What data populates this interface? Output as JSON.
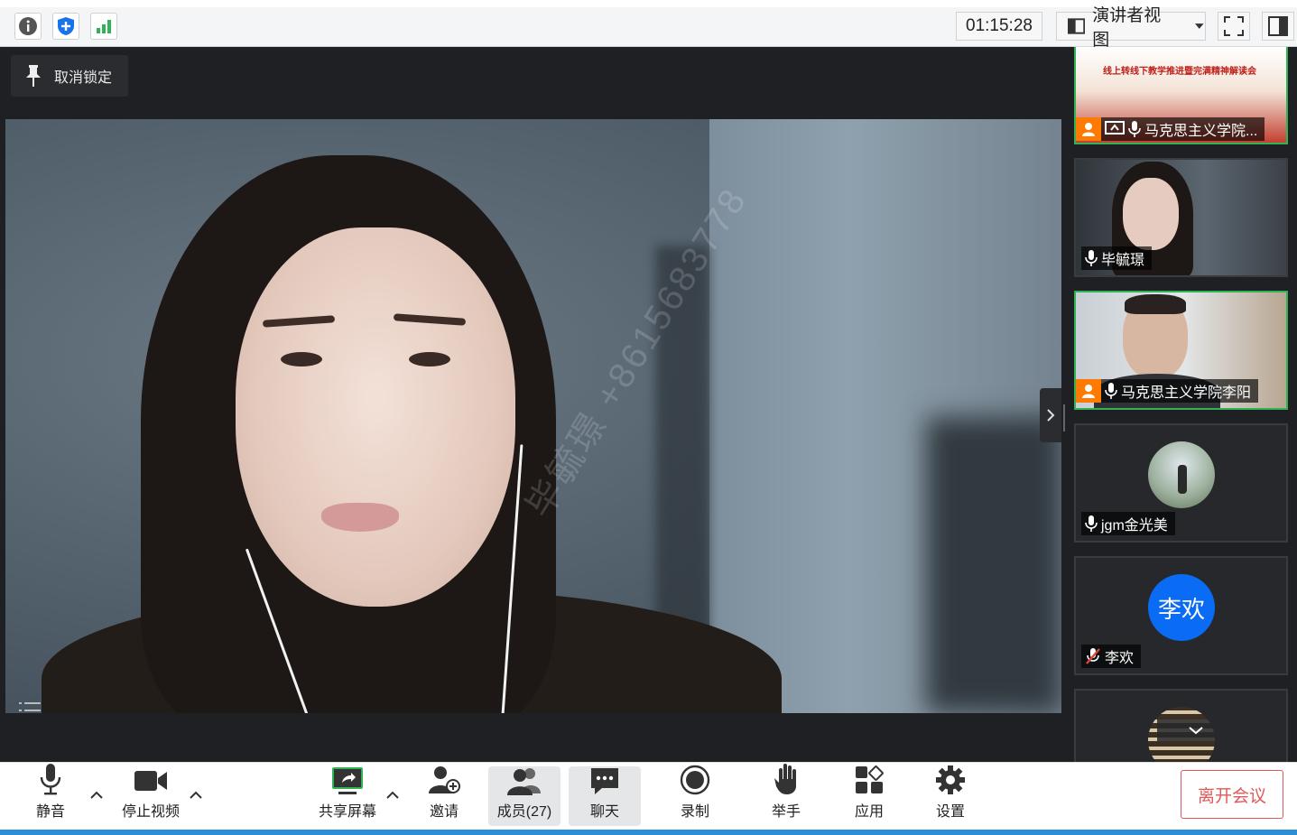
{
  "topbar": {
    "timer": "01:15:28",
    "view_label": "演讲者视图"
  },
  "stage": {
    "pin_label": "取消锁定",
    "watermark": "毕毓璟 +8615683778"
  },
  "gallery": {
    "tiles": [
      {
        "name": "马克思主义学院...",
        "slide_title": "线上转线下教学推进暨完满精神解读会",
        "host": true,
        "mic": "on"
      },
      {
        "name": "毕毓璟",
        "host": false,
        "mic": "on"
      },
      {
        "name": "马克思主义学院李阳",
        "host": true,
        "mic": "on"
      },
      {
        "name": "jgm金光美",
        "host": false,
        "mic": "on"
      },
      {
        "name": "李欢",
        "avatar_text": "李欢",
        "avatar_color": "#0a6cf5",
        "host": false,
        "mic": "muted"
      }
    ]
  },
  "toolbar": {
    "mute": "静音",
    "stop_video": "停止视频",
    "share_screen": "共享屏幕",
    "invite": "邀请",
    "members": "成员(27)",
    "chat": "聊天",
    "record": "录制",
    "raise_hand": "举手",
    "apps": "应用",
    "settings": "设置",
    "leave": "离开会议"
  },
  "colors": {
    "leave_red": "#e2585a",
    "active_tile": "#2fb355",
    "host_badge": "#ff7a00",
    "shield_blue": "#1a73e8",
    "signal_green": "#2fb355"
  }
}
